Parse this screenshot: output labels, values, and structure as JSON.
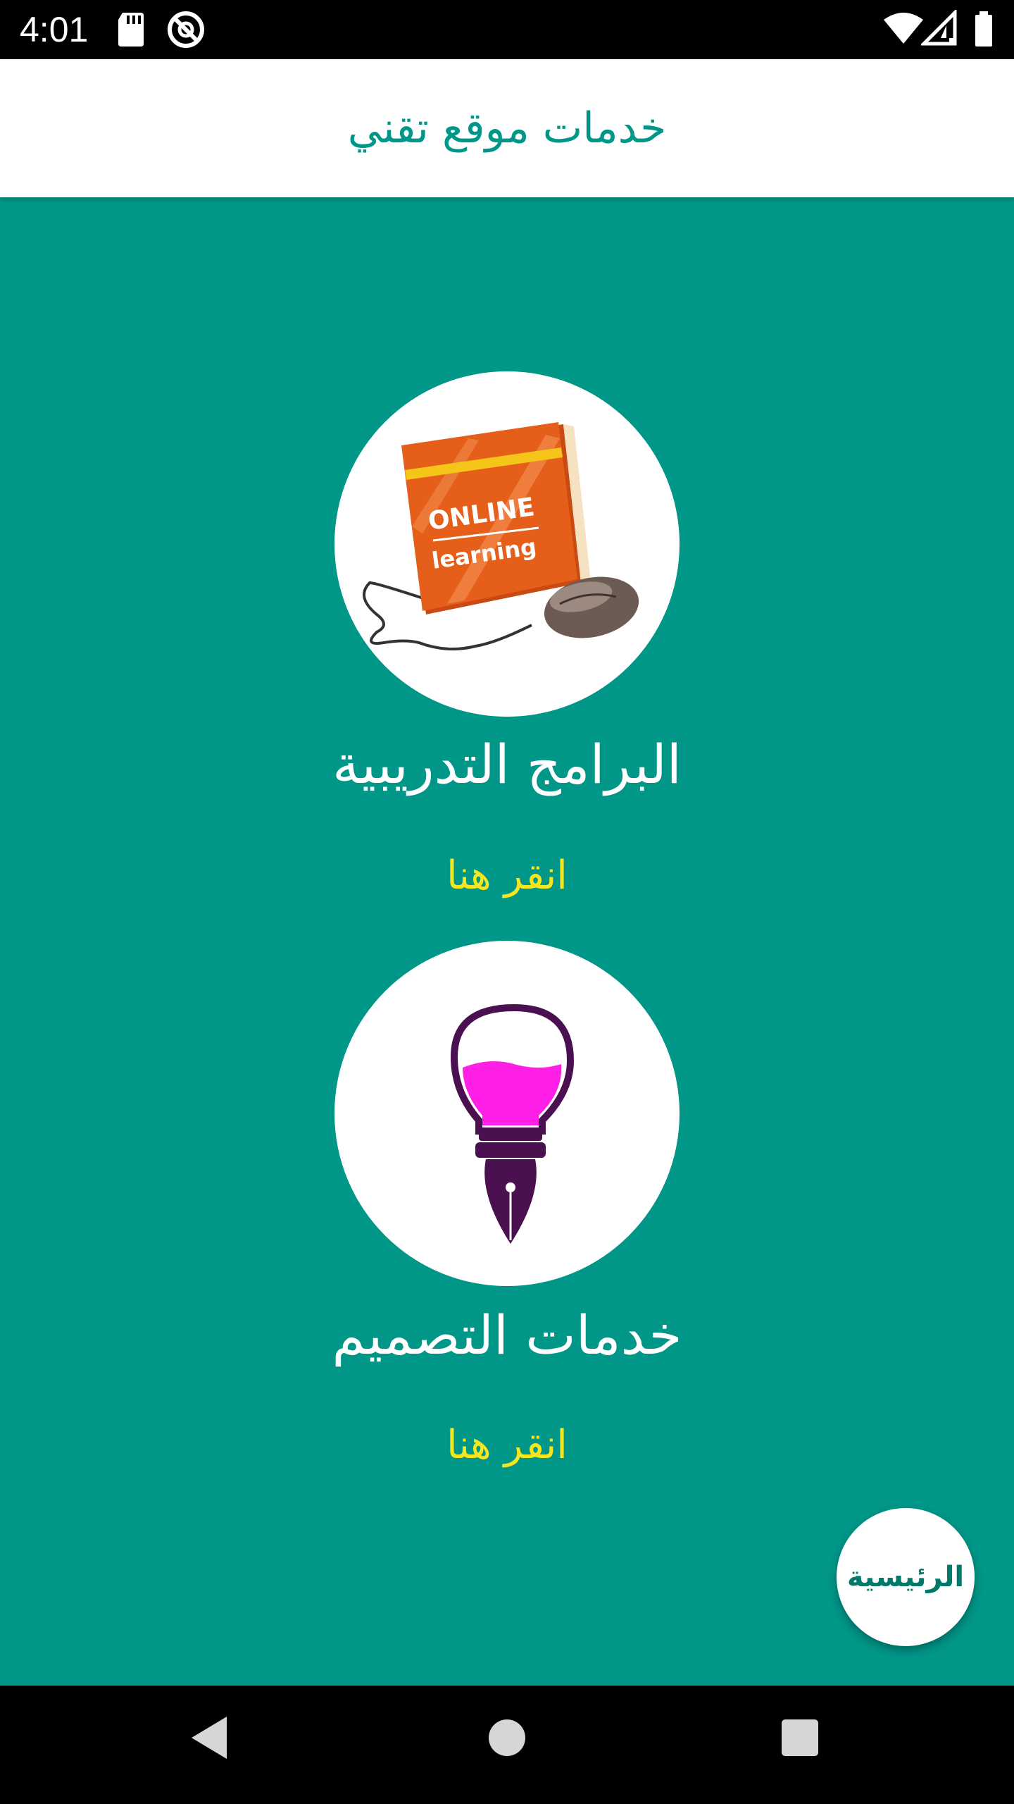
{
  "status_bar": {
    "time": "4:01",
    "icons": [
      "sd-card-icon",
      "do-not-disturb-icon",
      "wifi-icon",
      "cellular-signal-icon",
      "battery-icon"
    ]
  },
  "header": {
    "title": "خدمات موقع تقني"
  },
  "services": [
    {
      "title": "البرامج التدريبية",
      "link": "انقر هنا",
      "image_label_line1": "ONLINE",
      "image_label_line2": "learning",
      "icon": "online-learning-icon"
    },
    {
      "title": "خدمات التصميم",
      "link": "انقر هنا",
      "icon": "lightbulb-pen-icon"
    }
  ],
  "fab": {
    "label": "الرئيسية"
  },
  "nav": {
    "icons": [
      "back-icon",
      "home-icon",
      "recents-icon"
    ]
  },
  "colors": {
    "primary": "#009688",
    "link": "#f5e61f",
    "surface": "#ffffff"
  }
}
